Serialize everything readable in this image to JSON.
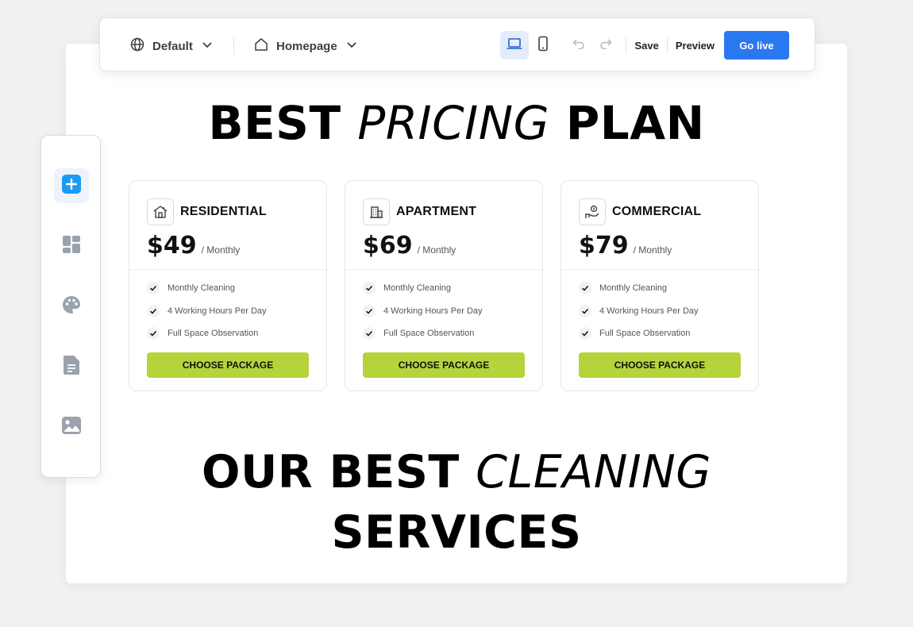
{
  "toolbar": {
    "locale_label": "Default",
    "page_label": "Homepage",
    "save_label": "Save",
    "preview_label": "Preview",
    "golive_label": "Go live"
  },
  "sidebar": {
    "items": [
      {
        "icon": "add-section-icon",
        "active": true
      },
      {
        "icon": "layout-grid-icon"
      },
      {
        "icon": "palette-icon"
      },
      {
        "icon": "document-icon"
      },
      {
        "icon": "image-icon"
      }
    ]
  },
  "pricing": {
    "heading_bold": "BEST",
    "heading_italic": "PRICING",
    "heading_bold2": "PLAN",
    "plans": [
      {
        "name": "RESIDENTIAL",
        "icon": "house-icon",
        "price": "$49",
        "period": "/ Monthly",
        "features": [
          "Monthly Cleaning",
          "4 Working Hours Per Day",
          "Full Space Observation"
        ],
        "button": "CHOOSE PACKAGE"
      },
      {
        "name": "APARTMENT",
        "icon": "building-icon",
        "price": "$69",
        "period": "/ Monthly",
        "features": [
          "Monthly Cleaning",
          "4 Working Hours Per Day",
          "Full Space Observation"
        ],
        "button": "CHOOSE PACKAGE"
      },
      {
        "name": "COMMERCIAL",
        "icon": "money-hand-icon",
        "price": "$79",
        "period": "/ Monthly",
        "features": [
          "Monthly Cleaning",
          "4 Working Hours Per Day",
          "Full Space Observation"
        ],
        "button": "CHOOSE PACKAGE"
      }
    ]
  },
  "services": {
    "heading_bold": "OUR BEST",
    "heading_italic": "CLEANING",
    "heading_line2": "SERVICES"
  },
  "colors": {
    "accent_button": "#b5d43b",
    "primary_blue": "#2a78f0",
    "side_active": "#1a9af5"
  }
}
